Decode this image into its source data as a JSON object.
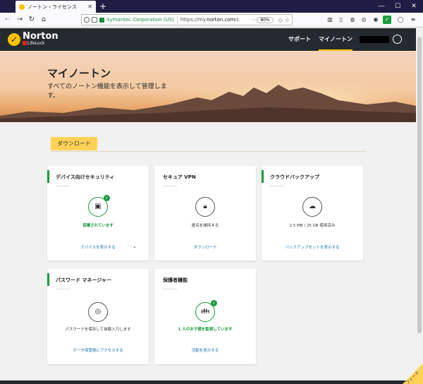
{
  "browser": {
    "tab_title": "ノートン・ライセンス",
    "tab_close": "✕",
    "new_tab": "+",
    "url_org": "Symantec Corporation (US)",
    "url_prefix": "https://my.",
    "url_domain": "norton.com",
    "url_suffix": "/c",
    "zoom": "80%"
  },
  "header": {
    "brand": "Norton",
    "brand_sub": "LifeLock",
    "nav_support": "サポート",
    "nav_my_norton": "マイノートン"
  },
  "hero": {
    "title": "マイノートン",
    "subtitle": "すべてのノートン機能を表示して管理します。"
  },
  "download_button": "ダウンロード",
  "cards": [
    {
      "title": "デバイス向けセキュリティ",
      "status": "保護されています",
      "link": "デバイスを表示する",
      "icon": "device-monitor-icon"
    },
    {
      "title": "セキュア VPN",
      "status": "匿名を維持する",
      "link": "ダウンロード",
      "icon": "lock-icon"
    },
    {
      "title": "クラウドバックアップ",
      "status": "2.5 MB / 25 GB 使用済み",
      "link": "バックアップセットを表示する",
      "icon": "cloud-upload-icon"
    },
    {
      "title": "パスワード マネージャー",
      "status": "パスワードを保存して自動入力します",
      "link": "データ保管庫にアクセスする",
      "icon": "fingerprint-icon"
    },
    {
      "title": "保護者機能",
      "status": "1 人のお子様を監視しています",
      "link": "活動を表示する",
      "icon": "family-icon"
    }
  ],
  "feedback": "フィード",
  "colors": {
    "accent": "#ffc300",
    "green": "#1d9a40",
    "link": "#1a73b6",
    "header": "#242a30"
  }
}
